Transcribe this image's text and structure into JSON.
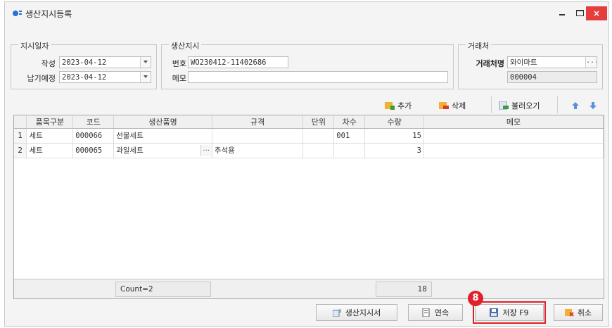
{
  "window": {
    "title": "생산지시등록",
    "close_label": "×"
  },
  "order_date": {
    "group_title": "지시일자",
    "created_label": "작성",
    "created_value": "2023-04-12",
    "due_label": "납기예정",
    "due_value": "2023-04-12"
  },
  "production": {
    "group_title": "생산지시",
    "number_label": "번호",
    "number_value": "WO230412-11402686",
    "memo_label": "메모",
    "memo_value": ""
  },
  "client": {
    "group_title": "거래처",
    "name_label": "거래처명",
    "name_value": "와이마트",
    "code_value": "000004",
    "ellipsis": "..."
  },
  "toolbar": {
    "add_label": "추가",
    "delete_label": "삭제",
    "load_label": "불러오기"
  },
  "grid": {
    "columns": [
      "품목구분",
      "코드",
      "생산품명",
      "규격",
      "단위",
      "차수",
      "수량",
      "메모"
    ],
    "rows": [
      {
        "no": "1",
        "category": "세트",
        "code": "000066",
        "product": "선물세트",
        "spec": "",
        "unit": "",
        "seq": "001",
        "qty": "15",
        "memo": ""
      },
      {
        "no": "2",
        "category": "세트",
        "code": "000065",
        "product": "과일세트",
        "spec": "추석용",
        "unit": "",
        "seq": "",
        "qty": "3",
        "memo": ""
      }
    ],
    "count_text": "Count=2",
    "qty_total": "18",
    "ellipsis": "..."
  },
  "actions": {
    "production_sheet_label": "생산지시서",
    "continuous_label": "연속",
    "save_label": "저장 F9",
    "cancel_label": "취소"
  },
  "annotation": {
    "step": "8"
  },
  "colors": {
    "highlight": "#e0202a",
    "close_button": "#e53e3e"
  }
}
